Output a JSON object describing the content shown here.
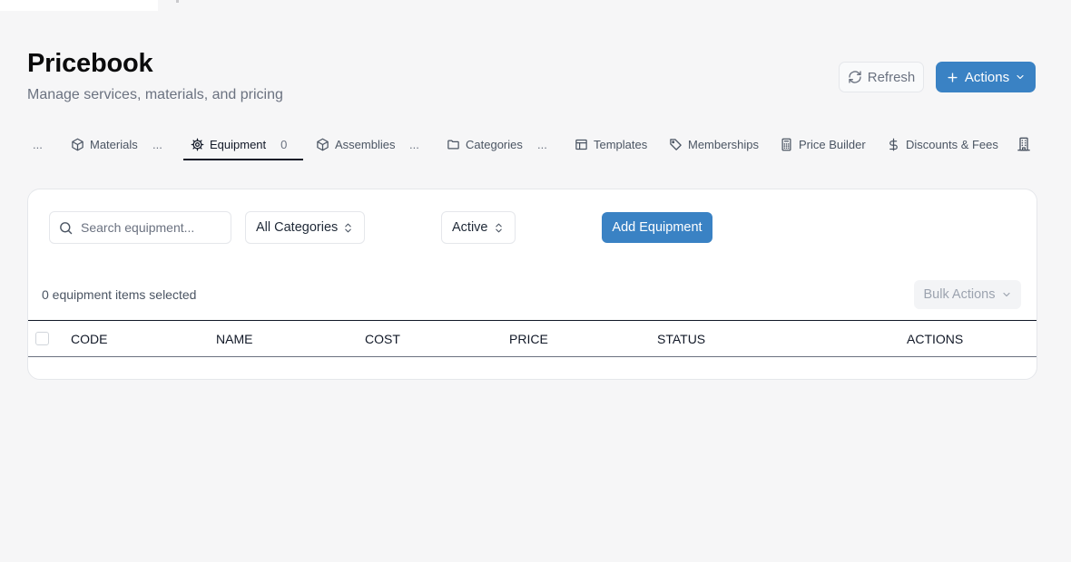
{
  "header": {
    "title": "Pricebook",
    "subtitle": "Manage services, materials, and pricing",
    "refresh_label": "Refresh",
    "actions_label": "Actions"
  },
  "tabs": [
    {
      "label": "Materials",
      "icon": "box-icon",
      "active": false
    },
    {
      "label": "Equipment",
      "icon": "gear-icon",
      "count": "0",
      "active": true
    },
    {
      "label": "Assemblies",
      "icon": "box-icon",
      "active": false
    },
    {
      "label": "Categories",
      "icon": "folder-icon",
      "active": false
    },
    {
      "label": "Templates",
      "icon": "layout-icon",
      "active": false
    },
    {
      "label": "Memberships",
      "icon": "tag-icon",
      "active": false
    },
    {
      "label": "Price Builder",
      "icon": "calculator-icon",
      "active": false
    },
    {
      "label": "Discounts & Fees",
      "icon": "dollar-icon",
      "active": false
    }
  ],
  "tab_ellipsis": "...",
  "filters": {
    "search_placeholder": "Search equipment...",
    "category": "All Categories",
    "status": "Active",
    "add_label": "Add Equipment"
  },
  "selection": {
    "text": "0 equipment items selected",
    "bulk_label": "Bulk Actions"
  },
  "table": {
    "columns": [
      "CODE",
      "NAME",
      "COST",
      "PRICE",
      "STATUS",
      "ACTIONS"
    ],
    "rows": []
  },
  "colors": {
    "accent": "#3a82c4",
    "background": "#f6f6f7"
  }
}
